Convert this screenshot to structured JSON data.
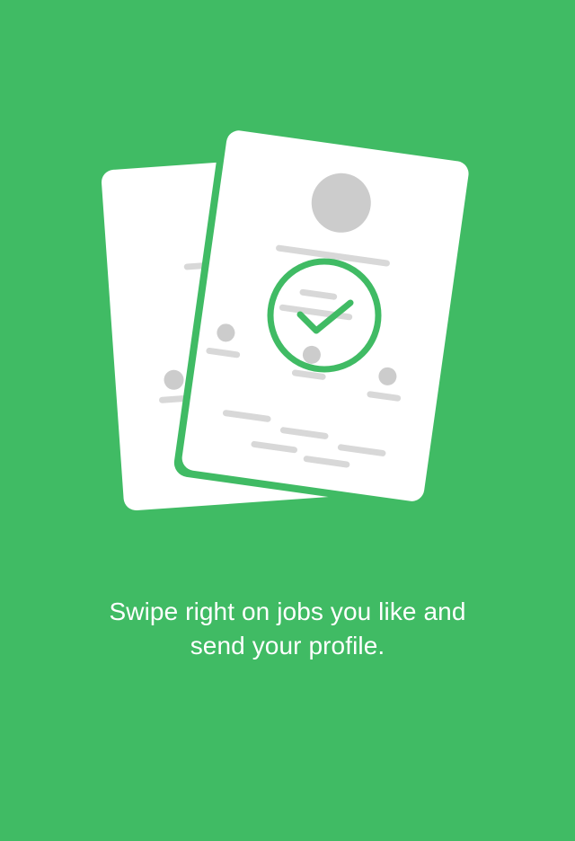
{
  "theme": {
    "background": "#40bb64",
    "card": "#ffffff",
    "placeholder": "#d8d8d8",
    "avatar": "#cccccc",
    "check_accent": "#40bb64"
  },
  "illustration": {
    "icon": "job-cards-check-icon"
  },
  "onboarding": {
    "line1": "Swipe right on jobs you like and",
    "line2": "send your profile."
  }
}
